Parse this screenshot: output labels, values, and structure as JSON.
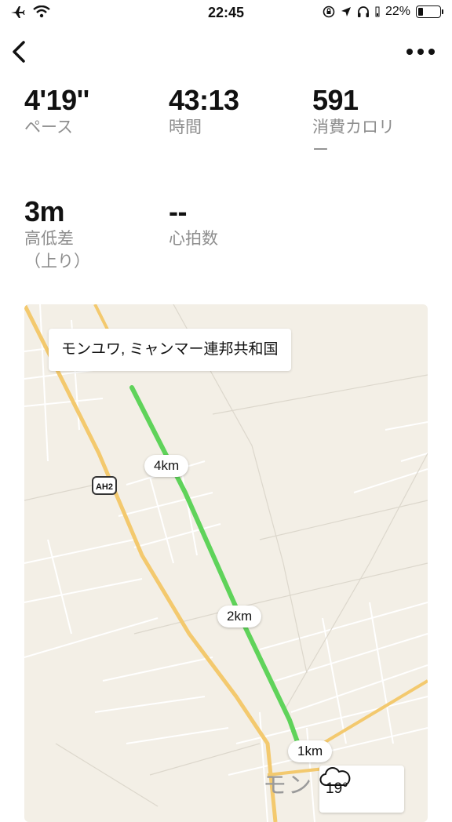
{
  "status": {
    "time": "22:45",
    "battery": "22%",
    "battery_level": 0.22
  },
  "nav": {
    "back_icon": "chevron-left-icon",
    "more_icon": "ellipsis-icon"
  },
  "metrics": [
    {
      "value": "4'19''",
      "label": "ペース"
    },
    {
      "value": "43:13",
      "label": "時間"
    },
    {
      "value": "591",
      "label": "消費カロリ\nー"
    },
    {
      "value": "3m",
      "label": "高低差\n（上り）"
    },
    {
      "value": "--",
      "label": "心拍数"
    }
  ],
  "map": {
    "location": "モンユワ, ミャンマー連邦共和国",
    "km_markers": [
      "4km",
      "2km",
      "1km"
    ],
    "road_shield": "AH2",
    "town_label": "モン",
    "route_color": "#5fd35a",
    "start_color": "#43c61f"
  },
  "weather": {
    "temperature": "19°",
    "icon": "cloud-icon"
  }
}
